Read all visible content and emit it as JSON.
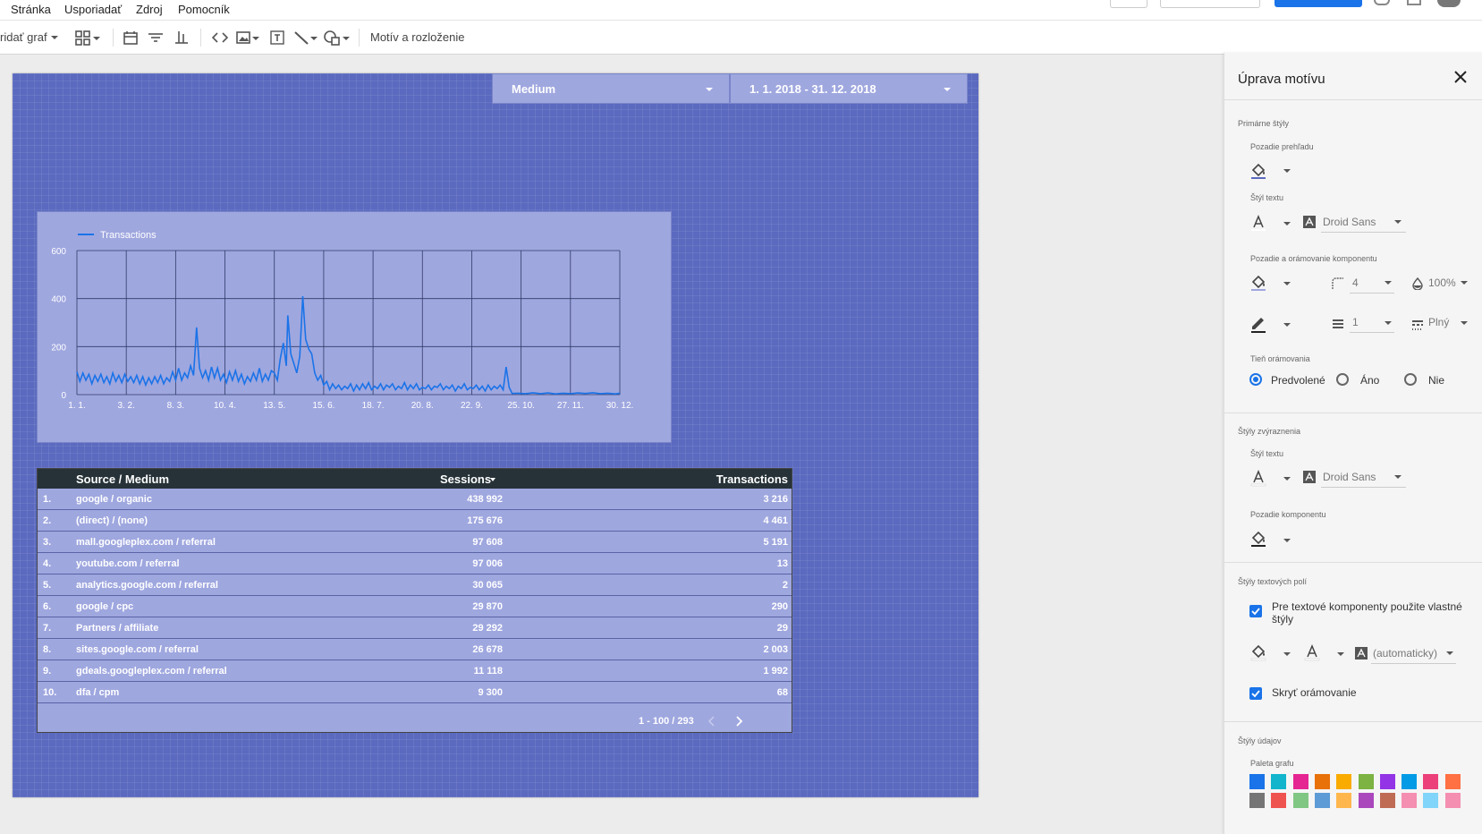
{
  "menu": {
    "items": [
      "Stránka",
      "Usporiadať",
      "Zdroj",
      "Pomocník"
    ]
  },
  "toolbar": {
    "add_chart": "ridať graf",
    "theme_layout": "Motív a rozloženie"
  },
  "filters": {
    "medium": "Medium",
    "date_range": "1. 1. 2018 - 31. 12. 2018"
  },
  "chart_data": {
    "type": "line",
    "legend": "Transactions",
    "ylim": [
      0,
      600
    ],
    "y_ticks": [
      "0",
      "200",
      "400",
      "600"
    ],
    "x_ticks": [
      "1. 1.",
      "3. 2.",
      "8. 3.",
      "10. 4.",
      "13. 5.",
      "15. 6.",
      "18. 7.",
      "20. 8.",
      "22. 9.",
      "25. 10.",
      "27. 11.",
      "30. 12."
    ],
    "x_range_days": [
      0,
      363
    ],
    "series": [
      {
        "name": "Transactions",
        "color": "#1a73e8",
        "points": [
          [
            0,
            95
          ],
          [
            2,
            55
          ],
          [
            4,
            90
          ],
          [
            6,
            60
          ],
          [
            8,
            85
          ],
          [
            10,
            45
          ],
          [
            12,
            80
          ],
          [
            14,
            55
          ],
          [
            16,
            85
          ],
          [
            18,
            50
          ],
          [
            20,
            75
          ],
          [
            22,
            45
          ],
          [
            24,
            90
          ],
          [
            26,
            55
          ],
          [
            28,
            80
          ],
          [
            30,
            50
          ],
          [
            32,
            85
          ],
          [
            34,
            55
          ],
          [
            36,
            75
          ],
          [
            38,
            50
          ],
          [
            40,
            80
          ],
          [
            42,
            45
          ],
          [
            44,
            75
          ],
          [
            46,
            40
          ],
          [
            48,
            70
          ],
          [
            50,
            45
          ],
          [
            52,
            75
          ],
          [
            54,
            50
          ],
          [
            56,
            80
          ],
          [
            58,
            45
          ],
          [
            60,
            70
          ],
          [
            62,
            55
          ],
          [
            64,
            95
          ],
          [
            66,
            60
          ],
          [
            68,
            110
          ],
          [
            70,
            60
          ],
          [
            72,
            90
          ],
          [
            74,
            70
          ],
          [
            76,
            120
          ],
          [
            78,
            80
          ],
          [
            80,
            280
          ],
          [
            82,
            110
          ],
          [
            84,
            70
          ],
          [
            86,
            100
          ],
          [
            88,
            60
          ],
          [
            90,
            115
          ],
          [
            92,
            70
          ],
          [
            94,
            110
          ],
          [
            96,
            60
          ],
          [
            98,
            85
          ],
          [
            100,
            50
          ],
          [
            102,
            95
          ],
          [
            104,
            60
          ],
          [
            106,
            100
          ],
          [
            108,
            55
          ],
          [
            110,
            85
          ],
          [
            112,
            45
          ],
          [
            114,
            75
          ],
          [
            116,
            55
          ],
          [
            118,
            90
          ],
          [
            120,
            60
          ],
          [
            122,
            110
          ],
          [
            124,
            55
          ],
          [
            126,
            85
          ],
          [
            128,
            60
          ],
          [
            130,
            100
          ],
          [
            132,
            90
          ],
          [
            134,
            60
          ],
          [
            136,
            150
          ],
          [
            138,
            215
          ],
          [
            140,
            120
          ],
          [
            141,
            330
          ],
          [
            143,
            170
          ],
          [
            145,
            130
          ],
          [
            147,
            90
          ],
          [
            149,
            160
          ],
          [
            151,
            410
          ],
          [
            153,
            230
          ],
          [
            155,
            190
          ],
          [
            157,
            170
          ],
          [
            159,
            90
          ],
          [
            161,
            60
          ],
          [
            163,
            80
          ],
          [
            165,
            40
          ],
          [
            167,
            55
          ],
          [
            169,
            20
          ],
          [
            171,
            45
          ],
          [
            173,
            25
          ],
          [
            175,
            40
          ],
          [
            177,
            20
          ],
          [
            179,
            35
          ],
          [
            181,
            25
          ],
          [
            183,
            45
          ],
          [
            185,
            15
          ],
          [
            187,
            40
          ],
          [
            189,
            20
          ],
          [
            191,
            45
          ],
          [
            193,
            25
          ],
          [
            195,
            50
          ],
          [
            197,
            20
          ],
          [
            199,
            35
          ],
          [
            201,
            25
          ],
          [
            203,
            45
          ],
          [
            205,
            20
          ],
          [
            207,
            40
          ],
          [
            209,
            30
          ],
          [
            211,
            45
          ],
          [
            213,
            20
          ],
          [
            215,
            35
          ],
          [
            217,
            25
          ],
          [
            219,
            50
          ],
          [
            221,
            20
          ],
          [
            223,
            40
          ],
          [
            225,
            25
          ],
          [
            227,
            45
          ],
          [
            229,
            20
          ],
          [
            231,
            30
          ],
          [
            233,
            25
          ],
          [
            235,
            40
          ],
          [
            237,
            20
          ],
          [
            239,
            35
          ],
          [
            241,
            30
          ],
          [
            243,
            45
          ],
          [
            245,
            20
          ],
          [
            247,
            35
          ],
          [
            249,
            25
          ],
          [
            251,
            40
          ],
          [
            253,
            15
          ],
          [
            255,
            35
          ],
          [
            257,
            25
          ],
          [
            259,
            45
          ],
          [
            261,
            20
          ],
          [
            263,
            30
          ],
          [
            265,
            25
          ],
          [
            267,
            40
          ],
          [
            269,
            20
          ],
          [
            271,
            35
          ],
          [
            273,
            15
          ],
          [
            275,
            40
          ],
          [
            277,
            20
          ],
          [
            279,
            35
          ],
          [
            281,
            25
          ],
          [
            283,
            40
          ],
          [
            285,
            20
          ],
          [
            287,
            115
          ],
          [
            289,
            30
          ],
          [
            291,
            5
          ],
          [
            295,
            6
          ],
          [
            300,
            4
          ],
          [
            305,
            8
          ],
          [
            310,
            4
          ],
          [
            315,
            7
          ],
          [
            320,
            3
          ],
          [
            325,
            6
          ],
          [
            330,
            4
          ],
          [
            335,
            7
          ],
          [
            340,
            5
          ],
          [
            345,
            8
          ],
          [
            350,
            4
          ],
          [
            355,
            6
          ],
          [
            360,
            3
          ],
          [
            363,
            6
          ]
        ]
      }
    ]
  },
  "table": {
    "headers": {
      "source": "Source / Medium",
      "sessions": "Sessions",
      "transactions": "Transactions"
    },
    "rows": [
      {
        "n": "1.",
        "source": "google / organic",
        "sessions": "438 992",
        "transactions": "3 216"
      },
      {
        "n": "2.",
        "source": "(direct) / (none)",
        "sessions": "175 676",
        "transactions": "4 461"
      },
      {
        "n": "3.",
        "source": "mall.googleplex.com / referral",
        "sessions": "97 608",
        "transactions": "5 191"
      },
      {
        "n": "4.",
        "source": "youtube.com / referral",
        "sessions": "97 006",
        "transactions": "13"
      },
      {
        "n": "5.",
        "source": "analytics.google.com / referral",
        "sessions": "30 065",
        "transactions": "2"
      },
      {
        "n": "6.",
        "source": "google / cpc",
        "sessions": "29 870",
        "transactions": "290"
      },
      {
        "n": "7.",
        "source": "Partners / affiliate",
        "sessions": "29 292",
        "transactions": "29"
      },
      {
        "n": "8.",
        "source": "sites.google.com / referral",
        "sessions": "26 678",
        "transactions": "2 003"
      },
      {
        "n": "9.",
        "source": "gdeals.googleplex.com / referral",
        "sessions": "11 118",
        "transactions": "1 992"
      },
      {
        "n": "10.",
        "source": "dfa / cpm",
        "sessions": "9 300",
        "transactions": "68"
      }
    ],
    "pagination": "1 - 100 / 293"
  },
  "panel": {
    "title": "Úprava motívu",
    "primary_styles": "Primárne štýly",
    "report_bg": "Pozadie prehľadu",
    "text_style": "Štýl textu",
    "font_primary": "Droid Sans",
    "component_bg_border": "Pozadie a orámovanie komponentu",
    "border_radius": "4",
    "opacity": "100%",
    "border_weight": "1",
    "border_style": "Plný",
    "border_shadow": "Tieň orámovania",
    "shadow_options": [
      "Predvolené",
      "Áno",
      "Nie"
    ],
    "shadow_selected": "Predvolené",
    "accent_styles": "Štýly zvýraznenia",
    "accent_text_style": "Štýl textu",
    "font_accent": "Droid Sans",
    "component_bg": "Pozadie komponentu",
    "textbox_styles": "Štýly textových polí",
    "custom_styles_label": "Pre textové komponenty použite vlastné štýly",
    "auto_font": "(automaticky)",
    "hide_border": "Skryť orámovanie",
    "data_styles": "Štýly údajov",
    "chart_palette": "Paleta grafu",
    "palette_row1": [
      "#1a73e8",
      "#12b5cb",
      "#e52592",
      "#e8710a",
      "#f9ab00",
      "#7cb342",
      "#9334e6",
      "#039be5",
      "#ec407a",
      "#ff7043"
    ],
    "palette_row2": [
      "#757575",
      "#ef5350",
      "#81c784",
      "#5c9bd5",
      "#ffb74d",
      "#ab47bc",
      "#bf6b54",
      "#f48fb1",
      "#81d4fa",
      "#f48fb1"
    ],
    "accent_color": "#1a73e8"
  }
}
